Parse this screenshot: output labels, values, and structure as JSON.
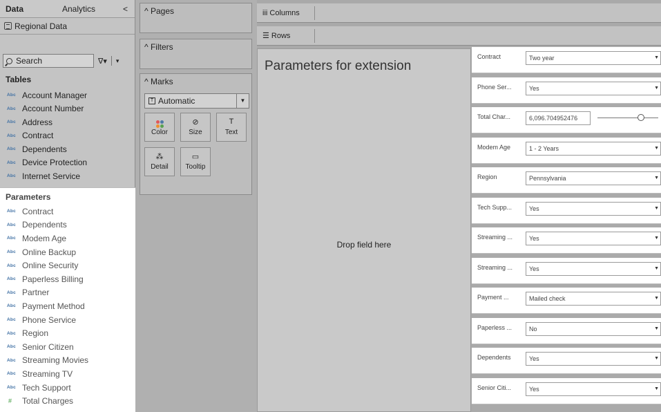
{
  "data_pane": {
    "tab_data": "Data",
    "tab_analytics": "Analytics",
    "collapse_glyph": "<",
    "datasource": "Regional Data",
    "search_placeholder": "Search",
    "filter_glyph": "∇▾",
    "menu_glyph": "▾",
    "tables_title": "Tables",
    "tables": [
      {
        "type": "Abc",
        "name": "Account Manager"
      },
      {
        "type": "Abc",
        "name": "Account Number"
      },
      {
        "type": "Abc",
        "name": "Address"
      },
      {
        "type": "Abc",
        "name": "Contract"
      },
      {
        "type": "Abc",
        "name": "Dependents"
      },
      {
        "type": "Abc",
        "name": "Device Protection"
      },
      {
        "type": "Abc",
        "name": "Internet Service"
      }
    ],
    "parameters_title": "Parameters",
    "parameters": [
      {
        "type": "Abc",
        "name": "Contract"
      },
      {
        "type": "Abc",
        "name": "Dependents"
      },
      {
        "type": "Abc",
        "name": "Modem Age"
      },
      {
        "type": "Abc",
        "name": "Online Backup"
      },
      {
        "type": "Abc",
        "name": "Online Security"
      },
      {
        "type": "Abc",
        "name": "Paperless Billing"
      },
      {
        "type": "Abc",
        "name": "Partner"
      },
      {
        "type": "Abc",
        "name": "Payment Method"
      },
      {
        "type": "Abc",
        "name": "Phone Service"
      },
      {
        "type": "Abc",
        "name": "Region"
      },
      {
        "type": "Abc",
        "name": "Senior Citizen"
      },
      {
        "type": "Abc",
        "name": "Streaming Movies"
      },
      {
        "type": "Abc",
        "name": "Streaming TV"
      },
      {
        "type": "Abc",
        "name": "Tech Support"
      },
      {
        "type": "#",
        "name": "Total Charges"
      }
    ]
  },
  "shelves": {
    "pages": "^ Pages",
    "filters": "^ Filters",
    "marks": "^ Marks",
    "mark_type": "Automatic",
    "mark_type_icon": "T",
    "color": "Color",
    "size": "Size",
    "text": "Text",
    "text_icon": "T",
    "size_icon": "⊘",
    "detail": "Detail",
    "detail_icon": "⁂",
    "tooltip": "Tooltip",
    "tooltip_icon": "▭",
    "color_dots": [
      "#e15759",
      "#4e79a7",
      "#f28e2b",
      "#59a14f"
    ]
  },
  "columns_label": "iii Columns",
  "rows_label": "☰ Rows",
  "view": {
    "title": "Parameters for extension",
    "drop_hint": "Drop field here"
  },
  "extension": {
    "rows": [
      {
        "label": "Contract",
        "value": "Two year",
        "kind": "select"
      },
      {
        "label": "Phone Ser...",
        "value": "Yes",
        "kind": "select"
      },
      {
        "label": "Total Char...",
        "value": "6,096.704952476",
        "kind": "slider"
      },
      {
        "label": "Modem Age",
        "value": "1 - 2 Years",
        "kind": "select"
      },
      {
        "label": "Region",
        "value": "Pennsylvania",
        "kind": "select"
      },
      {
        "label": "Tech Supp...",
        "value": "Yes",
        "kind": "select"
      },
      {
        "label": "Streaming ...",
        "value": "Yes",
        "kind": "select"
      },
      {
        "label": "Streaming ...",
        "value": "Yes",
        "kind": "select"
      },
      {
        "label": "Payment ...",
        "value": "Mailed check",
        "kind": "select"
      },
      {
        "label": "Paperless ...",
        "value": "No",
        "kind": "select"
      },
      {
        "label": "Dependents",
        "value": "Yes",
        "kind": "select"
      },
      {
        "label": "Senior Citi...",
        "value": "Yes",
        "kind": "select"
      }
    ]
  }
}
